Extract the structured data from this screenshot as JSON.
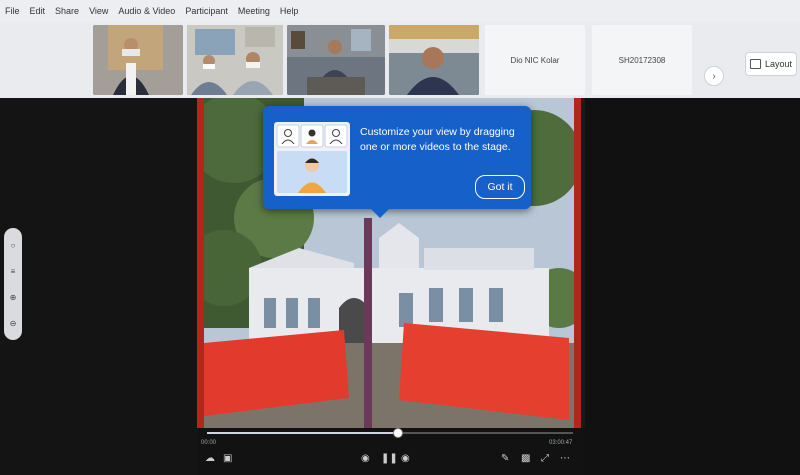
{
  "menu": [
    "File",
    "Edit",
    "Share",
    "View",
    "Audio & Video",
    "Participant",
    "Meeting",
    "Help"
  ],
  "participants": [
    {
      "label": "Dio NIC Kolar"
    },
    {
      "label": "SH20172308"
    }
  ],
  "layout_button": {
    "label": "Layout"
  },
  "strip_next_arrow": "›",
  "tooltip": {
    "text": "Customize your view by dragging one or more videos to the stage.",
    "button": "Got it"
  },
  "player": {
    "time_elapsed": "00:00",
    "time_total": "03:00:47",
    "progress": 0.52
  },
  "colors": {
    "accent": "#1560c9",
    "stage_frame": "#b3261e"
  }
}
